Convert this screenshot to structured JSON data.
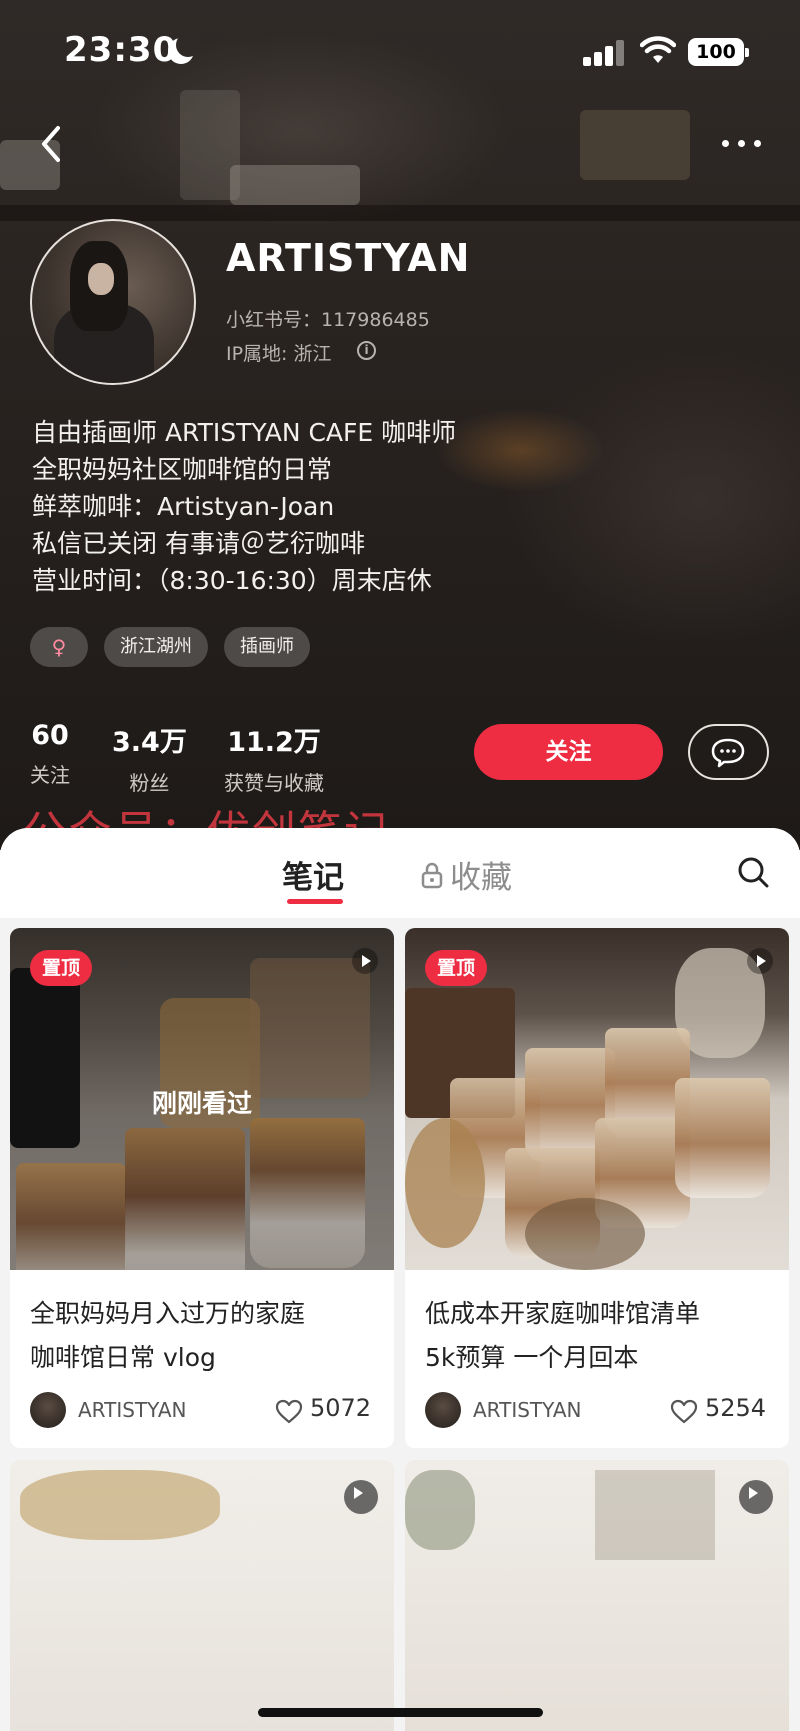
{
  "status_bar": {
    "time": "23:30",
    "battery": "100"
  },
  "profile": {
    "nickname": "ARTISTYAN",
    "red_id": "小红书号：117986485",
    "ip_location": "IP属地: 浙江",
    "bio_lines": [
      "自由插画师 ARTISTYAN CAFE 咖啡师",
      "全职妈妈社区咖啡馆的日常",
      "鲜萃咖啡：Artistyan-Joan",
      "私信已关闭 有事请＠艺衍咖啡",
      "营业时间：（8:30-16:30）周末店休"
    ],
    "tags": [
      "♀",
      "浙江湖州",
      "插画师"
    ],
    "stats": [
      {
        "value": "60",
        "label": "关注"
      },
      {
        "value": "3.4万",
        "label": "粉丝"
      },
      {
        "value": "11.2万",
        "label": "获赞与收藏"
      }
    ],
    "follow_label": "关注"
  },
  "watermark": "公众号：优创笔记",
  "tabs": {
    "notes": "笔记",
    "collections": "收藏"
  },
  "notes": [
    {
      "pin_label": "置顶",
      "overlay": "刚刚看过",
      "title_lines": [
        "全职妈妈月入过万的家庭",
        "咖啡馆日常 vlog"
      ],
      "author": "ARTISTYAN",
      "likes": "5072"
    },
    {
      "pin_label": "置顶",
      "title_lines": [
        "低成本开家庭咖啡馆清单",
        "5k预算 一个月回本"
      ],
      "author": "ARTISTYAN",
      "likes": "5254"
    }
  ],
  "colors": {
    "accent": "#ee2d43",
    "background_dark": "#2a2421"
  }
}
